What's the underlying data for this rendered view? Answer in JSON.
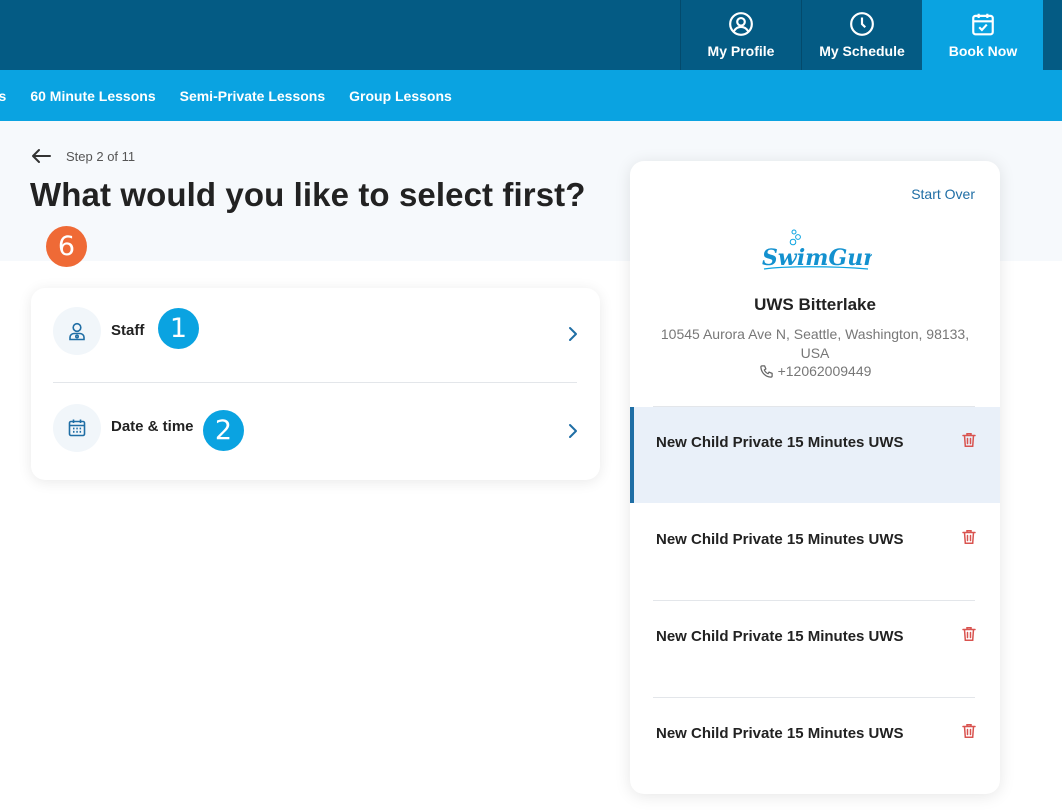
{
  "topnav": {
    "items": [
      {
        "label": "My Profile",
        "icon": "user-circle-icon"
      },
      {
        "label": "My Schedule",
        "icon": "clock-icon"
      },
      {
        "label": "Book Now",
        "icon": "calendar-check-icon",
        "active": true
      }
    ]
  },
  "subnav": {
    "items": [
      "ns",
      "60 Minute Lessons",
      "Semi-Private Lessons",
      "Group Lessons"
    ]
  },
  "page": {
    "step": "Step 2 of 11",
    "title": "What would you like to select first?"
  },
  "options": [
    {
      "label": "Staff",
      "icon": "staff-icon"
    },
    {
      "label": "Date & time",
      "icon": "calendar-icon"
    }
  ],
  "badges": {
    "title_badge": "6",
    "staff_badge": "1",
    "date_badge": "2"
  },
  "summary": {
    "start_over": "Start Over",
    "logo_text": "SwimGuru",
    "location_name": "UWS Bitterlake",
    "address": "10545 Aurora Ave N, Seattle, Washington, 98133, USA",
    "phone": "+12062009449",
    "lessons": [
      {
        "title": "New Child Private 15 Minutes UWS",
        "active": true
      },
      {
        "title": "New Child Private 15 Minutes UWS",
        "active": false
      },
      {
        "title": "New Child Private 15 Minutes UWS",
        "active": false
      },
      {
        "title": "New Child Private 15 Minutes UWS",
        "active": false
      }
    ]
  },
  "colors": {
    "topbar": "#045b84",
    "accent": "#0aa3e1",
    "badge_orange": "#ef6a36",
    "link": "#1f6ea5",
    "trash": "#d9534f"
  }
}
